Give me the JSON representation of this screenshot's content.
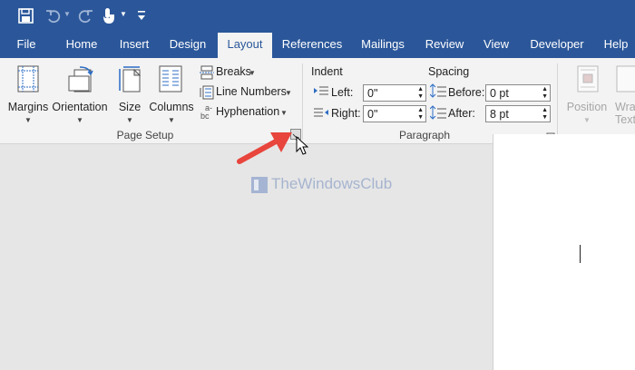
{
  "title_bar": {
    "save_icon": "save-icon",
    "undo_icon": "undo-icon",
    "redo_icon": "redo-icon",
    "touch_icon": "touch-mode-icon",
    "customize_icon": "customize-qat-icon",
    "bg_color": "#2b579a"
  },
  "tabs": [
    "File",
    "Home",
    "Insert",
    "Design",
    "Layout",
    "References",
    "Mailings",
    "Review",
    "View",
    "Developer",
    "Help"
  ],
  "active_tab": "Layout",
  "page_setup": {
    "margins": "Margins",
    "orientation": "Orientation",
    "size": "Size",
    "columns": "Columns",
    "breaks": "Breaks",
    "line_numbers": "Line Numbers",
    "hyphenation": "Hyphenation",
    "group_label": "Page Setup"
  },
  "paragraph": {
    "indent_label": "Indent",
    "left_label": "Left:",
    "left_value": "0\"",
    "right_label": "Right:",
    "right_value": "0\"",
    "spacing_label": "Spacing",
    "before_label": "Before:",
    "before_value": "0 pt",
    "after_label": "After:",
    "after_value": "8 pt",
    "group_label": "Paragraph"
  },
  "arrange": {
    "position": "Position",
    "wrap_text_1": "Wra",
    "wrap_text_2": "Text"
  },
  "watermark": "TheWindowsClub",
  "annotation": {
    "arrow_color": "#e8453c"
  }
}
